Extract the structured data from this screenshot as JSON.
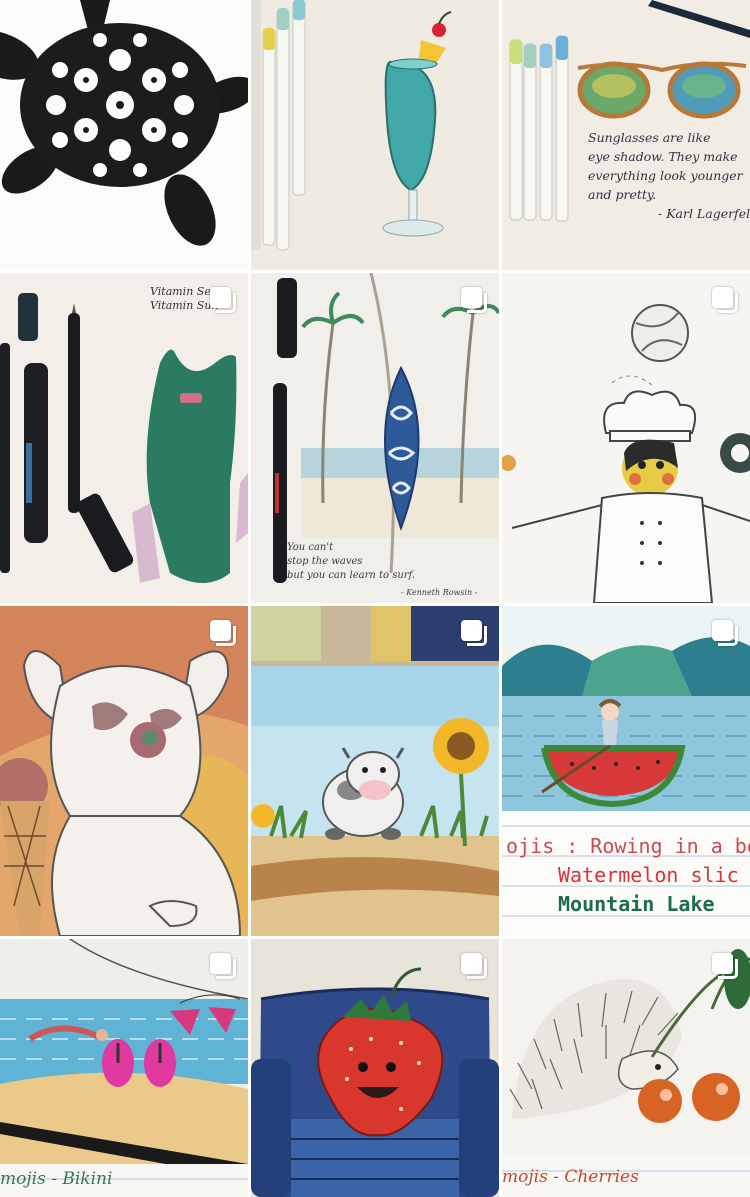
{
  "tiles": [
    {
      "name": "sea-turtle-drawing",
      "multi": false
    },
    {
      "name": "tropical-cocktail-drawing",
      "multi": false
    },
    {
      "name": "sunglasses-drawing",
      "multi": false,
      "quote": [
        "Sunglasses are like",
        "eye shadow. They make",
        "everything look younger",
        "and pretty.",
        "- Karl Lagerfeld -"
      ]
    },
    {
      "name": "swimsuit-drawing",
      "multi": true,
      "note": [
        "Vitamin Sea",
        "Vitamin Sun"
      ]
    },
    {
      "name": "surfboard-palm-drawing",
      "multi": true,
      "quote": [
        "You can't",
        "stop the waves",
        "but you can learn to surf."
      ],
      "author": "- Kenneth Rowsin -"
    },
    {
      "name": "chef-volleyball-drawing",
      "multi": true
    },
    {
      "name": "dog-icecream-drawing",
      "multi": true
    },
    {
      "name": "cow-sunflower-painting",
      "multi": true
    },
    {
      "name": "watermelon-boat-painting",
      "multi": true,
      "lines": [
        "ojis : Rowing in a boa",
        "Watermelon slic",
        "Mountain Lake"
      ],
      "colors": [
        "#c94a58",
        "#d8323a",
        "#1f6b4f"
      ]
    },
    {
      "name": "beach-bikini-drawing",
      "multi": true,
      "caption": "mojis  -  Bikini"
    },
    {
      "name": "strawberry-armchair-drawing",
      "multi": true
    },
    {
      "name": "hedgehog-cherries-drawing",
      "multi": true,
      "caption": "mojis  -  Cherries"
    }
  ]
}
